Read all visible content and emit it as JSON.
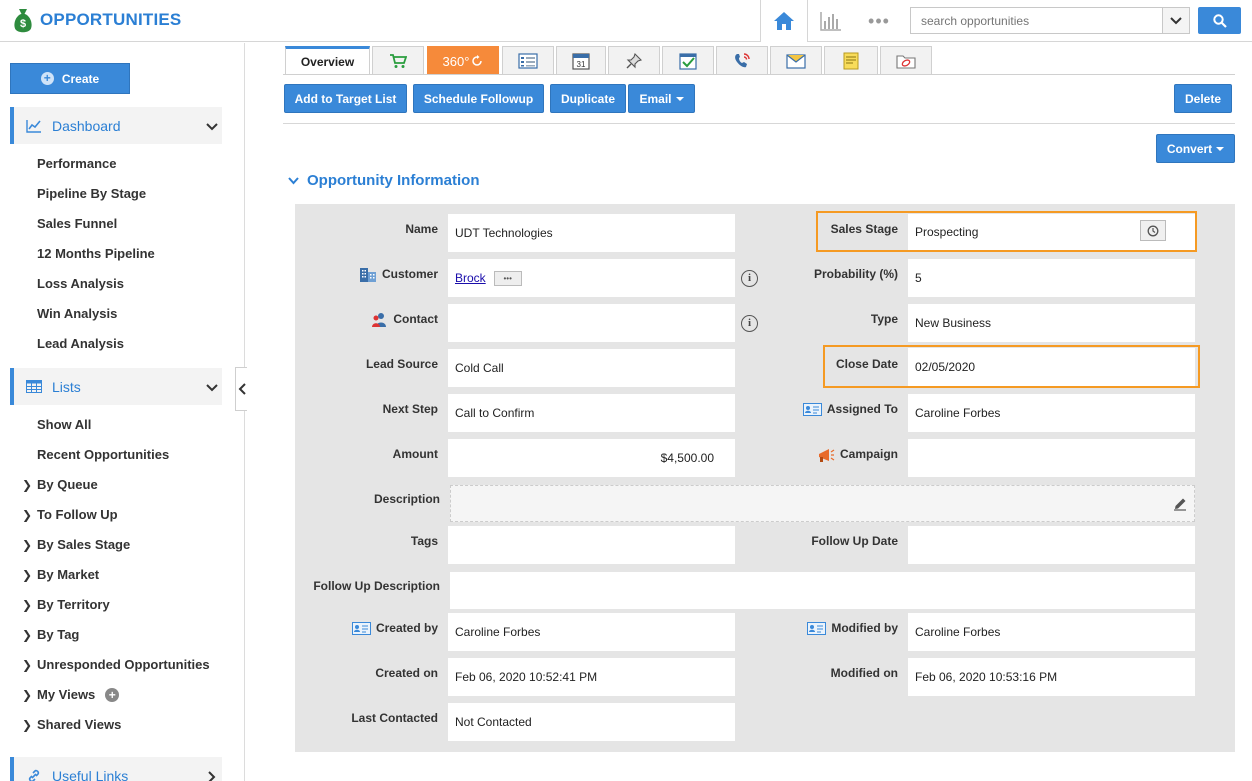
{
  "app": {
    "title": "OPPORTUNITIES"
  },
  "header": {
    "search_placeholder": "search opportunities",
    "more_label": "•••"
  },
  "sidebar": {
    "create_label": "Create",
    "dashboard": {
      "label": "Dashboard",
      "items": [
        "Performance",
        "Pipeline By Stage",
        "Sales Funnel",
        "12 Months Pipeline",
        "Loss Analysis",
        "Win Analysis",
        "Lead Analysis"
      ]
    },
    "lists": {
      "label": "Lists",
      "items": [
        "Show All",
        "Recent Opportunities"
      ],
      "folders": [
        "By Queue",
        "To Follow Up",
        "By Sales Stage",
        "By Market",
        "By Territory",
        "By Tag",
        "Unresponded Opportunities",
        "My Views",
        "Shared Views"
      ]
    },
    "useful_links": {
      "label": "Useful Links"
    }
  },
  "tabs": {
    "overview": "Overview",
    "t360": "360°"
  },
  "actions": {
    "add_to_target_list": "Add to Target List",
    "schedule_followup": "Schedule Followup",
    "duplicate": "Duplicate",
    "email": "Email",
    "delete": "Delete",
    "convert": "Convert"
  },
  "section": {
    "title": "Opportunity Information"
  },
  "fields": {
    "name": {
      "label": "Name",
      "value": "UDT Technologies"
    },
    "customer": {
      "label": "Customer",
      "value": "Brock",
      "more": "•••"
    },
    "contact": {
      "label": "Contact",
      "value": ""
    },
    "lead_source": {
      "label": "Lead Source",
      "value": "Cold Call"
    },
    "next_step": {
      "label": "Next Step",
      "value": "Call to Confirm"
    },
    "amount": {
      "label": "Amount",
      "value": "$4,500.00"
    },
    "description": {
      "label": "Description",
      "value": ""
    },
    "tags": {
      "label": "Tags",
      "value": ""
    },
    "follow_up_description": {
      "label": "Follow Up Description",
      "value": ""
    },
    "created_by": {
      "label": "Created by",
      "value": "Caroline Forbes"
    },
    "created_on": {
      "label": "Created on",
      "value": "Feb 06, 2020 10:52:41 PM"
    },
    "last_contacted": {
      "label": "Last Contacted",
      "value": "Not Contacted"
    },
    "sales_stage": {
      "label": "Sales Stage",
      "value": "Prospecting"
    },
    "probability": {
      "label": "Probability (%)",
      "value": "5"
    },
    "type": {
      "label": "Type",
      "value": "New Business"
    },
    "close_date": {
      "label": "Close Date",
      "value": "02/05/2020"
    },
    "assigned_to": {
      "label": "Assigned To",
      "value": "Caroline Forbes"
    },
    "campaign": {
      "label": "Campaign",
      "value": ""
    },
    "follow_up_date": {
      "label": "Follow Up Date",
      "value": ""
    },
    "modified_by": {
      "label": "Modified by",
      "value": "Caroline Forbes"
    },
    "modified_on": {
      "label": "Modified on",
      "value": "Feb 06, 2020 10:53:16 PM"
    }
  },
  "colors": {
    "accent": "#3a89d9",
    "title_blue": "#2b7fd4",
    "highlight": "#f59a23",
    "tab_360": "#f68a3a"
  }
}
